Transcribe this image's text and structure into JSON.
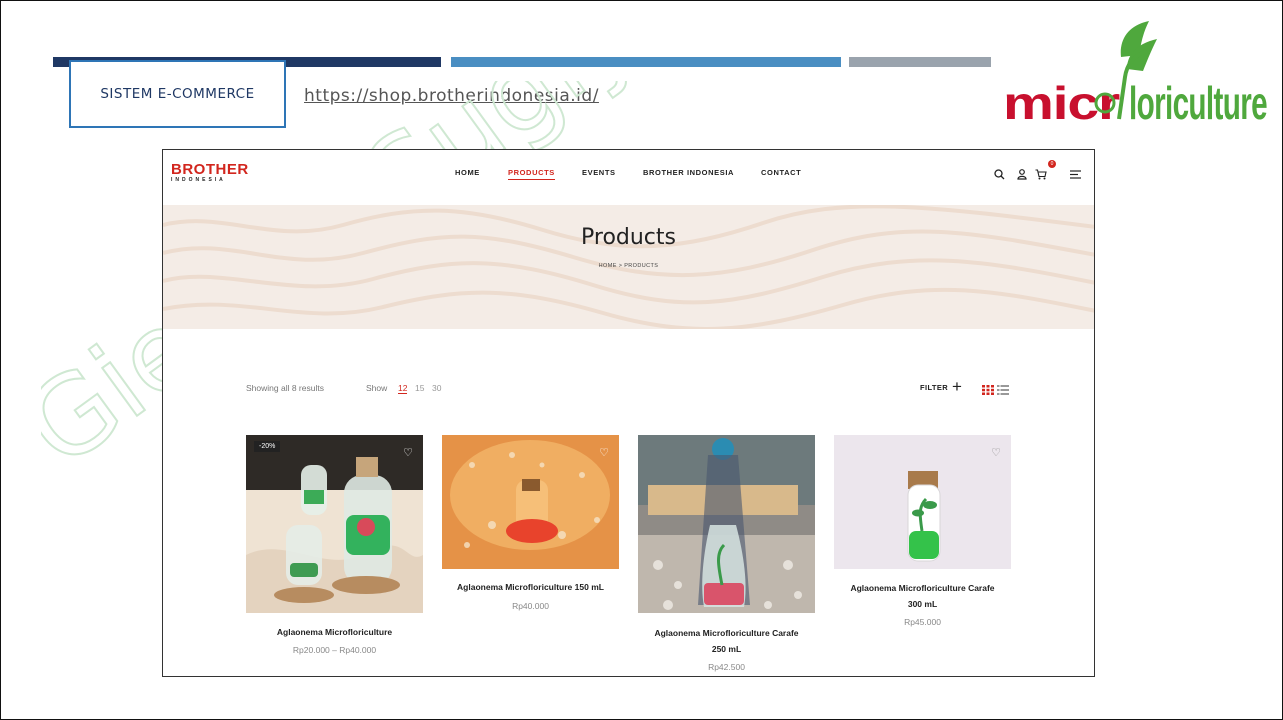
{
  "slide": {
    "tag": "SISTEM E-COMMERCE",
    "url": "https://shop.brotherindonesia.id/",
    "logo_text": "microfloriculture",
    "watermark": "Gieks – Sugiy"
  },
  "site": {
    "brand": {
      "main": "BROTHER",
      "sub": "INDONESIA"
    },
    "nav": [
      {
        "label": "HOME",
        "active": false
      },
      {
        "label": "PRODUCTS",
        "active": true
      },
      {
        "label": "EVENTS",
        "active": false
      },
      {
        "label": "BROTHER INDONESIA",
        "active": false
      },
      {
        "label": "CONTACT",
        "active": false
      }
    ],
    "icons": [
      "search-icon",
      "user-icon",
      "cart-icon",
      "menu-icon"
    ],
    "cart_count": "0",
    "hero": {
      "title": "Products",
      "breadcrumb": "HOME > PRODUCTS"
    },
    "toolbar": {
      "showing": "Showing all 8 results",
      "show_label": "Show",
      "show_options": [
        "12",
        "15",
        "30"
      ],
      "show_selected": "12",
      "filter_label": "FILTER"
    },
    "products": [
      {
        "name": "Aglaonema Microfloriculture",
        "price": "Rp20.000 – Rp40.000",
        "badge": "-20%"
      },
      {
        "name": "Aglaonema Microfloriculture 150 mL",
        "price": "Rp40.000",
        "badge": ""
      },
      {
        "name_line1": "Aglaonema Microfloriculture Carafe",
        "name_line2": "250 mL",
        "price": "Rp42.500",
        "badge": ""
      },
      {
        "name_line1": "Aglaonema Microfloriculture Carafe",
        "name_line2": "300 mL",
        "price": "Rp45.000",
        "badge": ""
      }
    ],
    "colors": {
      "brand_red": "#d2261e",
      "accent_blue": "#2e75b6",
      "navy": "#1f3864",
      "logo_red": "#c8102e",
      "logo_green": "#4fa83d"
    }
  }
}
